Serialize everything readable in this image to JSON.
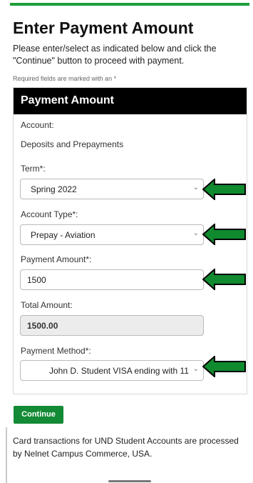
{
  "page": {
    "title": "Enter Payment Amount",
    "intro": "Please enter/select as indicated below and click the \"Continue\" button to proceed with payment.",
    "required_note": "Required fields are marked with an *"
  },
  "panel": {
    "header": "Payment Amount",
    "account_label": "Account:",
    "account_value": "Deposits and Prepayments",
    "term_label": "Term*:",
    "term_value": "Spring 2022",
    "account_type_label": "Account Type*:",
    "account_type_value": "Prepay - Aviation",
    "payment_amount_label": "Payment Amount*:",
    "payment_amount_value": "1500",
    "total_amount_label": "Total Amount:",
    "total_amount_value": "1500.00",
    "payment_method_label": "Payment Method*:",
    "payment_method_value": "John D. Student VISA ending with 11"
  },
  "actions": {
    "continue_label": "Continue"
  },
  "footer": {
    "note": "Card transactions for UND Student Accounts are processed by Nelnet Campus Commerce, USA."
  },
  "icons": {
    "chevron": "chevron-down-icon",
    "arrow": "left-arrow-pointer-icon"
  },
  "colors": {
    "accent_green": "#1e9e3a",
    "button_green": "#138a35",
    "arrow_green": "#0f8a2e",
    "header_black": "#000000"
  }
}
